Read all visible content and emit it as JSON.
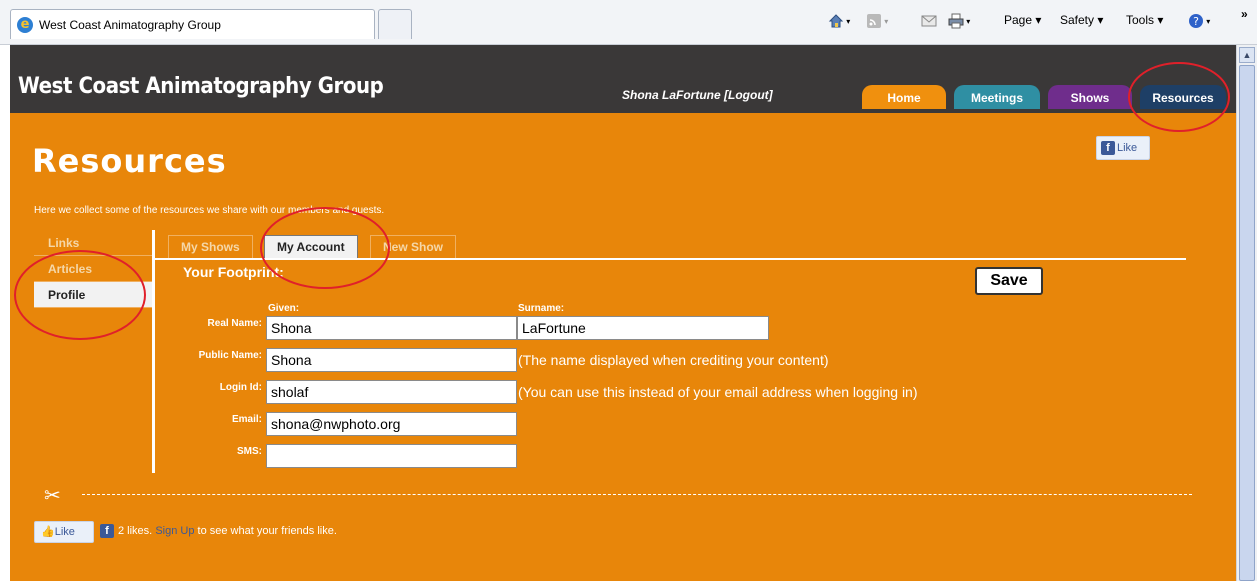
{
  "browser": {
    "tab_title": "West Coast Animatography Group",
    "commands": {
      "page": "Page ▾",
      "safety": "Safety ▾",
      "tools": "Tools ▾",
      "overflow": "»"
    }
  },
  "site": {
    "title": "West Coast Animatography Group",
    "user": "Shona LaFortune [Logout]",
    "nav": [
      "Home",
      "Meetings",
      "Shows",
      "Resources"
    ],
    "nav_colors": [
      "#f0900e",
      "#2f8fa3",
      "#6f2d8c",
      "#1e3f66"
    ]
  },
  "page": {
    "heading": "Resources",
    "intro": "Here we collect some of the resources we share with our members and guests.",
    "like_label": "Like",
    "side_nav": [
      "Links",
      "Articles",
      "Profile"
    ],
    "sub_tabs": [
      "My Shows",
      "My Account",
      "New Show"
    ]
  },
  "form": {
    "section_title": "Your Footprint:",
    "save_label": "Save",
    "given_label": "Given:",
    "surname_label": "Surname:",
    "real_name_label": "Real Name:",
    "public_name_label": "Public Name:",
    "login_id_label": "Login Id:",
    "email_label": "Email:",
    "sms_label": "SMS:",
    "given_value": "Shona",
    "surname_value": "LaFortune",
    "public_name_value": "Shona",
    "login_id_value": "sholaf",
    "email_value": "shona@nwphoto.org",
    "sms_value": "",
    "public_name_hint": "(The name displayed when crediting your content)",
    "login_id_hint": "(You can use this instead of your email address when logging in)"
  },
  "footer": {
    "like_label": "Like",
    "likes_count_text": "2 likes.",
    "signup_link": "Sign Up",
    "likes_suffix": " to see what your friends like."
  }
}
